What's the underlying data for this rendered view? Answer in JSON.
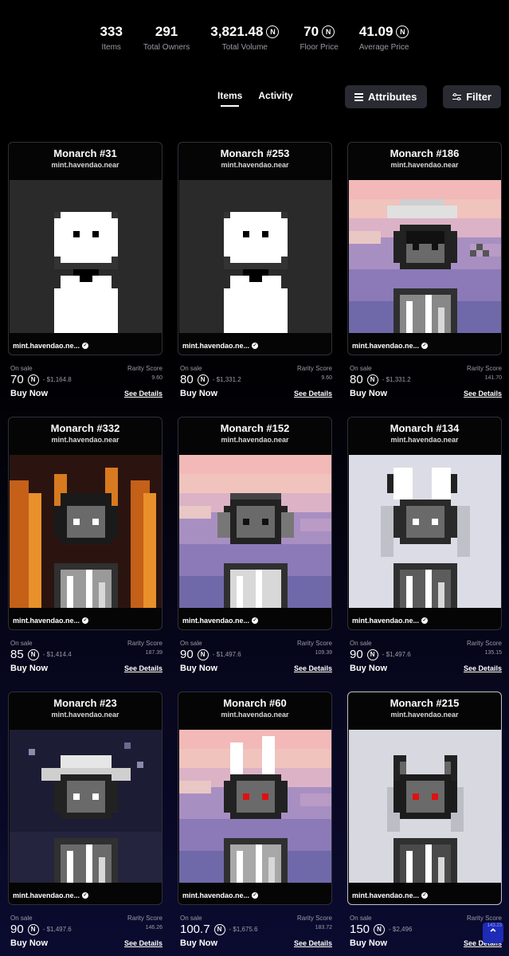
{
  "stats": [
    {
      "value": "333",
      "label": "Items",
      "near": false
    },
    {
      "value": "291",
      "label": "Total Owners",
      "near": false
    },
    {
      "value": "3,821.48",
      "label": "Total Volume",
      "near": true
    },
    {
      "value": "70",
      "label": "Floor Price",
      "near": true
    },
    {
      "value": "41.09",
      "label": "Average Price",
      "near": true
    }
  ],
  "near_symbol": "N",
  "tabs": {
    "items": "Items",
    "activity": "Activity"
  },
  "toolbar": {
    "attributes": "Attributes",
    "filter": "Filter"
  },
  "labels": {
    "on_sale": "On sale",
    "rarity": "Rarity Score",
    "buy_now": "Buy Now",
    "see_details": "See Details"
  },
  "cards": [
    {
      "title": "Monarch #31",
      "collection": "mint.havendao.near",
      "owner": "mint.havendao.ne...",
      "price": "70",
      "usd": "- $1,164.8",
      "rarity": "9.60",
      "art": "ghost"
    },
    {
      "title": "Monarch #253",
      "collection": "mint.havendao.near",
      "owner": "mint.havendao.ne...",
      "price": "80",
      "usd": "- $1,331.2",
      "rarity": "9.60",
      "art": "ghost"
    },
    {
      "title": "Monarch #186",
      "collection": "mint.havendao.near",
      "owner": "mint.havendao.ne...",
      "price": "80",
      "usd": "- $1,331.2",
      "rarity": "141.70",
      "art": "sunset-hat"
    },
    {
      "title": "Monarch #332",
      "collection": "mint.havendao.near",
      "owner": "mint.havendao.ne...",
      "price": "85",
      "usd": "- $1,414.4",
      "rarity": "187.39",
      "art": "fire"
    },
    {
      "title": "Monarch #152",
      "collection": "mint.havendao.near",
      "owner": "mint.havendao.ne...",
      "price": "90",
      "usd": "- $1,497.6",
      "rarity": "109.39",
      "art": "sunset-headphones"
    },
    {
      "title": "Monarch #134",
      "collection": "mint.havendao.near",
      "owner": "mint.havendao.ne...",
      "price": "90",
      "usd": "- $1,497.6",
      "rarity": "135.15",
      "art": "bunny-grey"
    },
    {
      "title": "Monarch #23",
      "collection": "mint.havendao.near",
      "owner": "mint.havendao.ne...",
      "price": "90",
      "usd": "- $1,497.6",
      "rarity": "146.26",
      "art": "night-cowboy"
    },
    {
      "title": "Monarch #60",
      "collection": "mint.havendao.near",
      "owner": "mint.havendao.ne...",
      "price": "100.7",
      "usd": "- $1,675.6",
      "rarity": "183.72",
      "art": "sunset-bunny"
    },
    {
      "title": "Monarch #215",
      "collection": "mint.havendao.near",
      "owner": "mint.havendao.ne...",
      "price": "150",
      "usd": "- $2,496",
      "rarity": "143.23",
      "art": "cat-grey"
    }
  ],
  "scroll_top": {
    "badge": "143.23",
    "icon": "chevron-up-icon"
  },
  "colors": {
    "accent": "#1d2bb7",
    "card_border": "#2f2f3a"
  }
}
